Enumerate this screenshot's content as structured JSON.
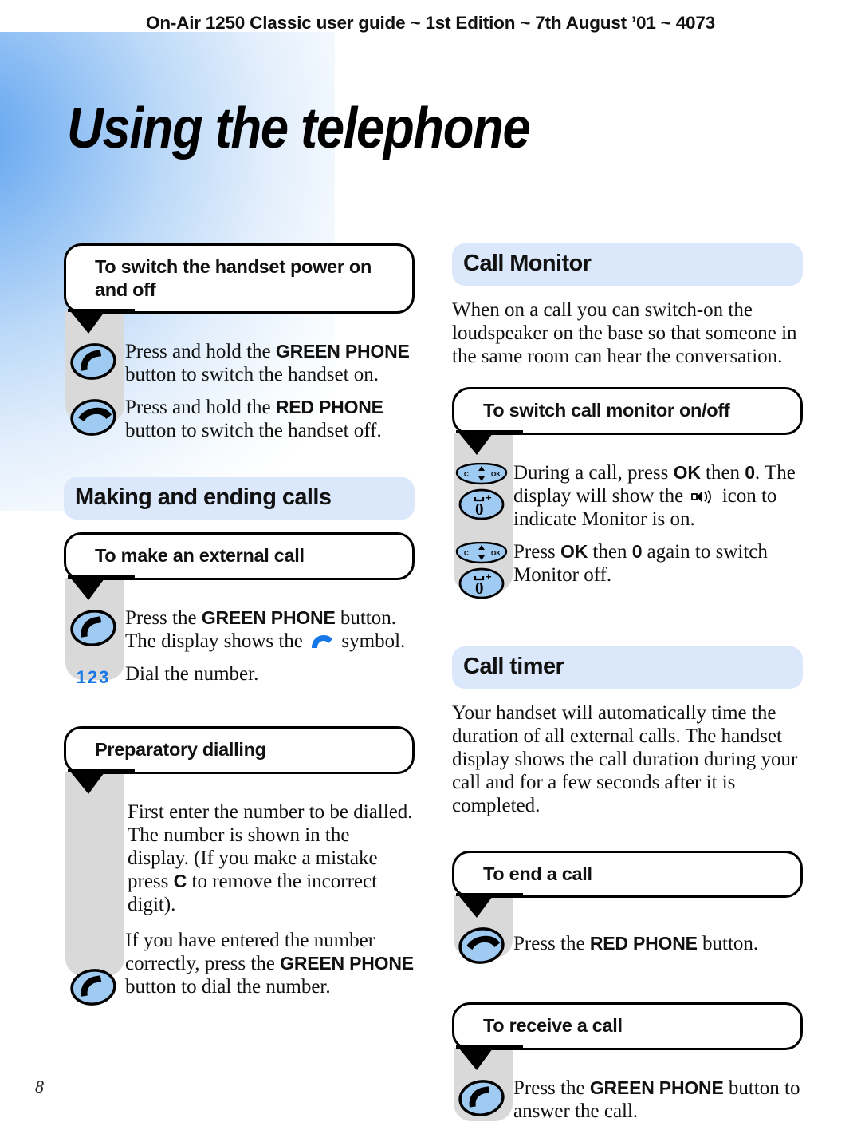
{
  "header": {
    "running_head": "On-Air 1250 Classic user guide ~ 1st Edition ~ 7th August ’01 ~ 4073"
  },
  "chapter": {
    "title": "Using the telephone"
  },
  "footer": {
    "page_number": "8"
  },
  "colors": {
    "pill_heading_bg": "#dbe8fb",
    "icon_rail_bg": "#d9d9d9",
    "key_icon_fill": "#9fcbf2",
    "accent_blue": "#1577e8",
    "corner_glow": "#5fa3ef"
  },
  "left_column": {
    "section_power": {
      "bubble_title": "To switch the handset power on and off",
      "rows": [
        {
          "icon": "green-phone-key-icon",
          "text_parts": [
            {
              "t": "Press and hold the ",
              "bold": false
            },
            {
              "t": "GREEN PHONE",
              "bold": true
            },
            {
              "t": " button to switch the handset on.",
              "bold": false
            }
          ]
        },
        {
          "icon": "red-phone-key-icon",
          "text_parts": [
            {
              "t": "Press and hold the ",
              "bold": false
            },
            {
              "t": "RED PHONE",
              "bold": true
            },
            {
              "t": " button to switch the handset off.",
              "bold": false
            }
          ]
        }
      ]
    },
    "section_making": {
      "pill_title": "Making and ending calls",
      "sub_external": {
        "bubble_title": "To make an external call",
        "rows": [
          {
            "icon": "green-phone-key-icon",
            "text_parts": [
              {
                "t": "Press the ",
                "bold": false
              },
              {
                "t": "GREEN PHONE",
                "bold": true
              },
              {
                "t": " button. The display shows the ",
                "bold": false
              },
              {
                "t": "[handset-symbol]",
                "bold": false,
                "glyph": "blue-handset-icon"
              },
              {
                "t": " symbol.",
                "bold": false
              }
            ]
          },
          {
            "icon": "digits-123-icon",
            "text_parts": [
              {
                "t": "Dial the number.",
                "bold": false
              }
            ]
          }
        ]
      },
      "sub_preparatory": {
        "bubble_title": "Preparatory dialling",
        "paragraph_1_parts": [
          {
            "t": "First enter the number to be dialled. The number is shown in the display. (If you make a mistake press ",
            "bold": false
          },
          {
            "t": "C",
            "bold": true
          },
          {
            "t": " to remove the incorrect digit).",
            "bold": false
          }
        ],
        "rows": [
          {
            "icon": "green-phone-key-icon",
            "text_parts": [
              {
                "t": "If you have entered the number correctly, press the ",
                "bold": false
              },
              {
                "t": "GREEN PHONE",
                "bold": true
              },
              {
                "t": " button to dial the number.",
                "bold": false
              }
            ]
          }
        ]
      }
    }
  },
  "right_column": {
    "section_monitor": {
      "pill_title": "Call Monitor",
      "intro": "When on a call you can switch-on the loudspeaker on the base so that someone in the same room can hear the conversation.",
      "sub_switch": {
        "bubble_title": "To switch call monitor on/off",
        "rows": [
          {
            "icons": [
              "nav-c-ok-key-icon",
              "zero-key-icon"
            ],
            "text_parts": [
              {
                "t": "During a call, press ",
                "bold": false
              },
              {
                "t": "OK",
                "bold": true
              },
              {
                "t": " then ",
                "bold": false
              },
              {
                "t": "0",
                "bold": true
              },
              {
                "t": ". The display will show the ",
                "bold": false
              },
              {
                "t": "[speaker-symbol]",
                "bold": false,
                "glyph": "loudspeaker-icon"
              },
              {
                "t": " icon to indicate Monitor is on.",
                "bold": false
              }
            ]
          },
          {
            "icons": [
              "nav-c-ok-key-icon",
              "zero-key-icon"
            ],
            "text_parts": [
              {
                "t": "Press ",
                "bold": false
              },
              {
                "t": "OK",
                "bold": true
              },
              {
                "t": " then ",
                "bold": false
              },
              {
                "t": "0",
                "bold": true
              },
              {
                "t": " again to switch Monitor off.",
                "bold": false
              }
            ]
          }
        ]
      }
    },
    "section_timer": {
      "pill_title": "Call timer",
      "intro": "Your handset will automatically time the duration of all external calls. The handset display shows the call duration during your call and for a few seconds after it is completed."
    },
    "section_end_call": {
      "bubble_title": "To end a call",
      "rows": [
        {
          "icon": "red-phone-key-icon",
          "text_parts": [
            {
              "t": "Press the ",
              "bold": false
            },
            {
              "t": "RED PHONE",
              "bold": true
            },
            {
              "t": " button.",
              "bold": false
            }
          ]
        }
      ]
    },
    "section_receive_call": {
      "bubble_title": "To receive a call",
      "rows": [
        {
          "icon": "green-phone-key-icon",
          "text_parts": [
            {
              "t": "Press the ",
              "bold": false
            },
            {
              "t": "GREEN PHONE",
              "bold": true
            },
            {
              "t": " button to answer the call.",
              "bold": false
            }
          ]
        }
      ]
    }
  },
  "key_icon_labels": {
    "nav_left": "C",
    "nav_right": "OK",
    "zero": "0",
    "plus": "+",
    "digits": "123"
  }
}
